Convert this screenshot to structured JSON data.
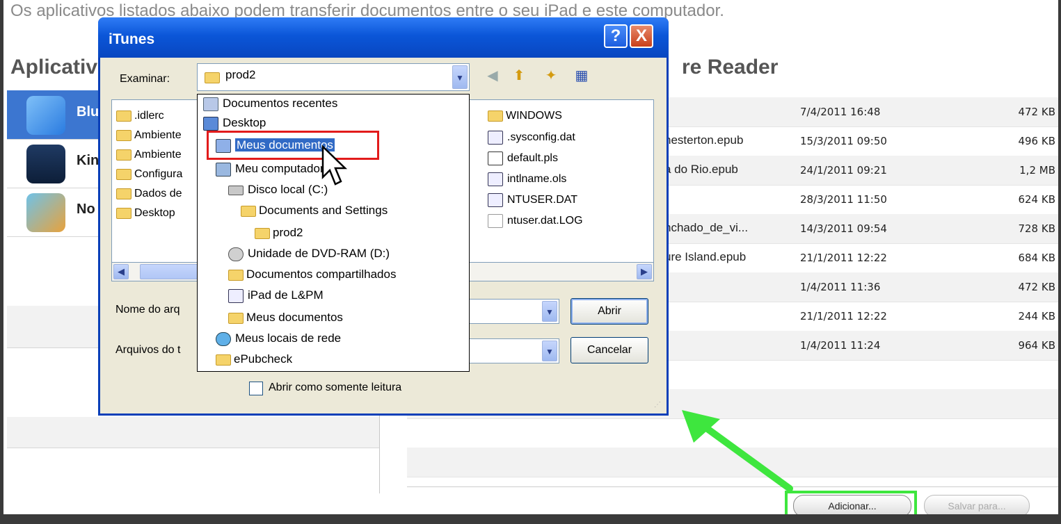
{
  "intro_text": "Os aplicativos listados abaixo podem transferir documentos entre o seu iPad e este computador.",
  "heading": "Aplicativos",
  "heading_right": "re Reader",
  "apps": [
    {
      "name": "Blu",
      "icon": "bluefire-reader-icon",
      "selected": true
    },
    {
      "name": "Kin",
      "icon": "kindle-icon",
      "selected": false
    },
    {
      "name": "No",
      "icon": "notes-icon",
      "selected": false
    }
  ],
  "files": [
    {
      "name": "",
      "date": "7/4/2011 16:48",
      "size": "472 KB"
    },
    {
      "name": "nesterton.epub",
      "date": "15/3/2011 09:50",
      "size": "496 KB"
    },
    {
      "name": "a do Rio.epub",
      "date": "24/1/2011 09:21",
      "size": "1,2 MB"
    },
    {
      "name": "",
      "date": "28/3/2011 11:50",
      "size": "624 KB"
    },
    {
      "name": "nchado_de_vi...",
      "date": "14/3/2011 09:54",
      "size": "728 KB"
    },
    {
      "name": "ure Island.epub",
      "date": "21/1/2011 12:22",
      "size": "684 KB"
    },
    {
      "name": "",
      "date": "1/4/2011 11:36",
      "size": "472 KB"
    },
    {
      "name": "",
      "date": "21/1/2011 12:22",
      "size": "244 KB"
    },
    {
      "name": "",
      "date": "1/4/2011 11:24",
      "size": "964 KB"
    }
  ],
  "buttons": {
    "add": "Adicionar...",
    "save": "Salvar para..."
  },
  "dialog": {
    "title": "iTunes",
    "help": "?",
    "close": "X",
    "look_in_label": "Examinar:",
    "look_in_value": "prod2",
    "filename_label": "Nome do arq",
    "filetype_label": "Arquivos do t",
    "open_button": "Abrir",
    "cancel_button": "Cancelar",
    "readonly_label": "Abrir como somente leitura",
    "left_items": [
      ".idlerc",
      "Ambiente",
      "Ambiente",
      "Configura",
      "Dados de",
      "Desktop"
    ],
    "right_items": [
      {
        "name": "WINDOWS",
        "icon": "folder-icon"
      },
      {
        "name": ".sysconfig.dat",
        "icon": "file-icon"
      },
      {
        "name": "default.pls",
        "icon": "audio-file-icon"
      },
      {
        "name": "intlname.ols",
        "icon": "file-icon"
      },
      {
        "name": "NTUSER.DAT",
        "icon": "file-icon"
      },
      {
        "name": "ntuser.dat.LOG",
        "icon": "text-file-icon"
      }
    ],
    "dropdown": [
      {
        "label": "Documentos recentes",
        "icon": "recent-documents-icon",
        "indent": 0
      },
      {
        "label": "Desktop",
        "icon": "desktop-icon",
        "indent": 0
      },
      {
        "label": "Meus documentos",
        "icon": "my-documents-icon",
        "indent": 1,
        "highlighted": true
      },
      {
        "label": "Meu computador",
        "icon": "my-computer-icon",
        "indent": 1
      },
      {
        "label": "Disco local (C:)",
        "icon": "local-disk-icon",
        "indent": 2
      },
      {
        "label": "Documents and Settings",
        "icon": "folder-icon",
        "indent": 3
      },
      {
        "label": "prod2",
        "icon": "folder-icon",
        "indent": 4
      },
      {
        "label": "Unidade de DVD-RAM (D:)",
        "icon": "dvd-drive-icon",
        "indent": 2
      },
      {
        "label": "Documentos compartilhados",
        "icon": "folder-icon",
        "indent": 2
      },
      {
        "label": "iPad de L&PM",
        "icon": "ipad-device-icon",
        "indent": 2
      },
      {
        "label": "Meus documentos",
        "icon": "folder-icon",
        "indent": 2
      },
      {
        "label": "Meus locais de rede",
        "icon": "network-places-icon",
        "indent": 1
      },
      {
        "label": "ePubcheck",
        "icon": "folder-icon",
        "indent": 1
      }
    ]
  },
  "colors": {
    "accent_selection": "#3c76d0",
    "xp_title_blue": "#0b56d8",
    "highlight_red": "#e21b1b",
    "annotation_green": "#3ee63e"
  }
}
